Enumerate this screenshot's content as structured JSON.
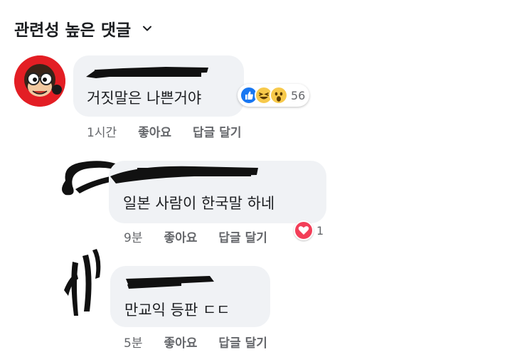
{
  "header": {
    "title": "관련성 높은 댓글"
  },
  "comments": [
    {
      "text": "거짓말은 나쁜거야",
      "time": "1시간",
      "like": "좋아요",
      "reply": "답글 달기",
      "reaction_count": "56",
      "reactions": [
        "like-icon",
        "haha-icon",
        "wow-icon"
      ]
    },
    {
      "text": "일본 사람이 한국말 하네",
      "time": "9분",
      "like": "좋아요",
      "reply": "답글 달기",
      "reaction_count": "1",
      "reactions": [
        "love-icon"
      ]
    },
    {
      "text": "만교익 등판 ㄷㄷ",
      "time": "5분",
      "like": "좋아요",
      "reply": "답글 달기"
    }
  ],
  "colors": {
    "bubble": "#f0f2f5",
    "meta_text": "#65676b",
    "like_blue": "#1877f2",
    "love_red": "#f33e58",
    "emoji_yellow": "#f7c94b"
  }
}
